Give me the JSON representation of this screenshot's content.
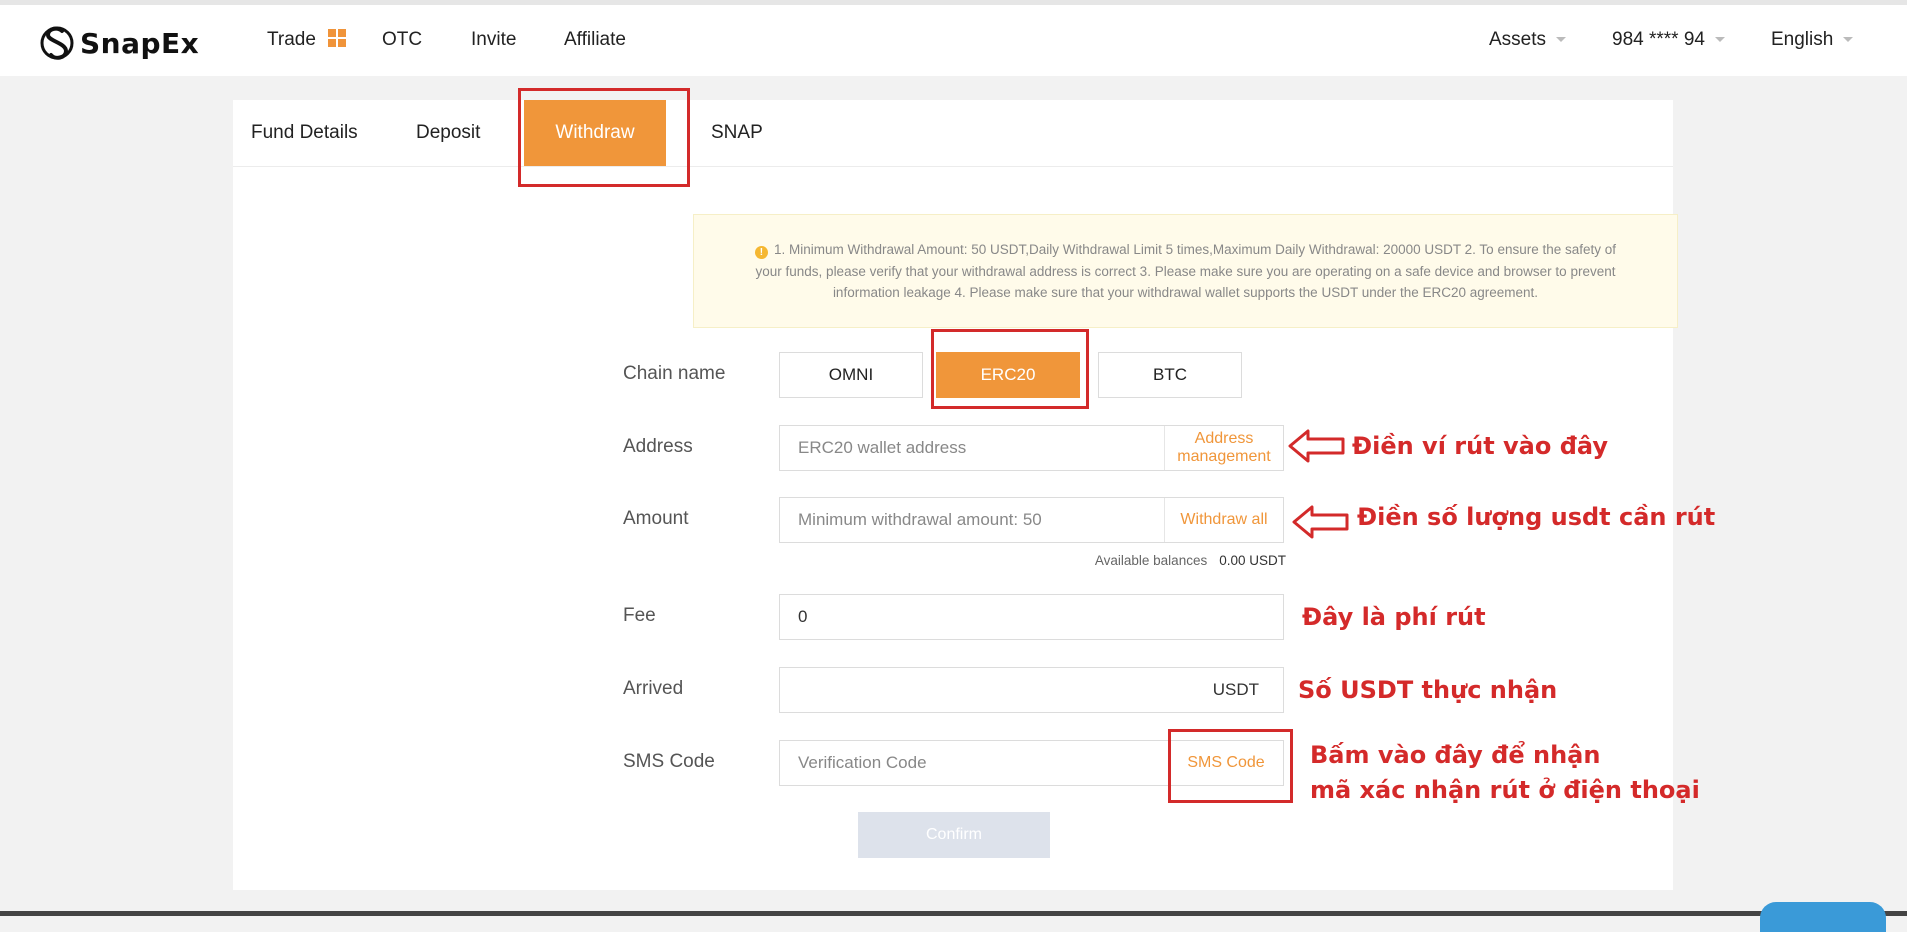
{
  "header": {
    "brand": "SnapEx",
    "nav": [
      "Trade",
      "OTC",
      "Invite",
      "Affiliate"
    ],
    "assets": "Assets",
    "account": "984 **** 94",
    "language": "English"
  },
  "tabs": [
    "Fund Details",
    "Deposit",
    "Withdraw",
    "SNAP"
  ],
  "active_tab": "Withdraw",
  "notice": {
    "line1": "1. Minimum Withdrawal Amount:  50 USDT,Daily Withdrawal Limit 5 times,Maximum Daily Withdrawal: 20000 USDT  2. To ensure the safety of",
    "line2": "your funds, please verify that your withdrawal address is correct  3. Please make sure you are operating on a safe device and browser to prevent",
    "line3": "information leakage  4. Please make sure that your withdrawal wallet supports the USDT under the ERC20 agreement."
  },
  "form": {
    "chain": {
      "label": "Chain name",
      "options": [
        "OMNI",
        "ERC20",
        "BTC"
      ],
      "selected": "ERC20"
    },
    "address": {
      "label": "Address",
      "placeholder": "ERC20 wallet address",
      "action_line1": "Address",
      "action_line2": "management"
    },
    "amount": {
      "label": "Amount",
      "placeholder": "Minimum withdrawal amount: 50",
      "action": "Withdraw all",
      "balance_label": "Available balances",
      "balance_value": "0.00 USDT"
    },
    "fee": {
      "label": "Fee",
      "value": "0"
    },
    "arrived": {
      "label": "Arrived",
      "unit": "USDT"
    },
    "sms": {
      "label": "SMS Code",
      "placeholder": "Verification Code",
      "action": "SMS Code"
    },
    "confirm": "Confirm"
  },
  "annotations": {
    "address": "Điền ví rút vào đây",
    "amount": "Điền số lượng usdt cần rút",
    "fee": "Đây là phí rút",
    "arrived": "Số USDT thực nhận",
    "sms_line1": "Bấm vào đây để nhận",
    "sms_line2": "mã xác nhận rút ở điện thoại"
  },
  "colors": {
    "accent": "#f0963a",
    "annotation_red": "#d32a2a",
    "notice_bg": "#fffbea"
  }
}
